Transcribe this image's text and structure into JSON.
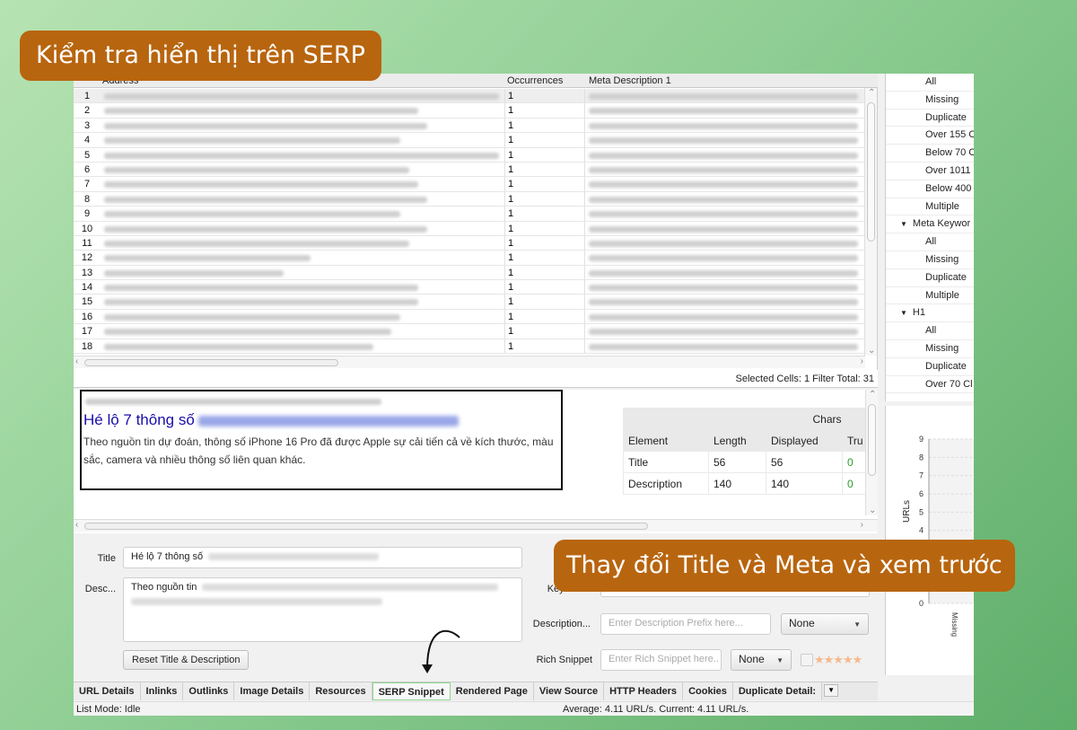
{
  "callouts": {
    "top": "Kiểm tra hiển thị trên SERP",
    "bottom": "Thay đổi Title và Meta và xem trước"
  },
  "grid": {
    "columns": [
      "Address",
      "Occurrences",
      "Meta Description 1"
    ],
    "rows": [
      {
        "n": "1",
        "occ": "1"
      },
      {
        "n": "2",
        "occ": "1"
      },
      {
        "n": "3",
        "occ": "1"
      },
      {
        "n": "4",
        "occ": "1"
      },
      {
        "n": "5",
        "occ": "1"
      },
      {
        "n": "6",
        "occ": "1"
      },
      {
        "n": "7",
        "occ": "1"
      },
      {
        "n": "8",
        "occ": "1"
      },
      {
        "n": "9",
        "occ": "1"
      },
      {
        "n": "10",
        "occ": "1"
      },
      {
        "n": "11",
        "occ": "1"
      },
      {
        "n": "12",
        "occ": "1"
      },
      {
        "n": "13",
        "occ": "1"
      },
      {
        "n": "14",
        "occ": "1"
      },
      {
        "n": "15",
        "occ": "1"
      },
      {
        "n": "16",
        "occ": "1"
      },
      {
        "n": "17",
        "occ": "1"
      },
      {
        "n": "18",
        "occ": "1"
      }
    ],
    "filter_status": "Selected Cells: 1  Filter Total:  31"
  },
  "tree": [
    {
      "label": "All",
      "type": "child"
    },
    {
      "label": "Missing",
      "type": "child"
    },
    {
      "label": "Duplicate",
      "type": "child"
    },
    {
      "label": "Over 155 C",
      "type": "child"
    },
    {
      "label": "Below 70 C",
      "type": "child"
    },
    {
      "label": "Over 1011",
      "type": "child"
    },
    {
      "label": "Below 400",
      "type": "child"
    },
    {
      "label": "Multiple",
      "type": "child"
    },
    {
      "label": "Meta Keywor",
      "type": "parent"
    },
    {
      "label": "All",
      "type": "child"
    },
    {
      "label": "Missing",
      "type": "child"
    },
    {
      "label": "Duplicate",
      "type": "child"
    },
    {
      "label": "Multiple",
      "type": "child"
    },
    {
      "label": "H1",
      "type": "parent"
    },
    {
      "label": "All",
      "type": "child"
    },
    {
      "label": "Missing",
      "type": "child"
    },
    {
      "label": "Duplicate",
      "type": "child"
    },
    {
      "label": "Over 70 Cl",
      "type": "child"
    }
  ],
  "chart_data": {
    "type": "bar",
    "ylabel": "URLs",
    "yticks": [
      "9",
      "8",
      "7",
      "6",
      "5",
      "4",
      "0"
    ],
    "ylim": [
      0,
      9
    ],
    "categories": [
      "Missing"
    ],
    "values": [
      0
    ]
  },
  "serp": {
    "title_visible": "Hé lộ 7 thông số",
    "description": "Theo nguồn tin dự đoán, thông số iPhone 16 Pro đã được Apple sự cải tiến cả về kích thước, màu sắc, camera và nhiều thông số liên quan khác."
  },
  "chars_table": {
    "group_header": "Chars",
    "headers": [
      "Element",
      "Length",
      "Displayed",
      "Tru"
    ],
    "rows": [
      {
        "element": "Title",
        "length": "56",
        "displayed": "56",
        "truncated": "0"
      },
      {
        "element": "Description",
        "length": "140",
        "displayed": "140",
        "truncated": "0"
      }
    ]
  },
  "editor": {
    "title_label": "Title",
    "title_value": "Hé lộ 7 thông số",
    "desc_label": "Desc...",
    "desc_value": "Theo nguồn tin",
    "reset_button": "Reset Title & Description",
    "keyword_label": "Keywords",
    "desc_prefix_label": "Description...",
    "desc_prefix_placeholder": "Enter Description Prefix here...",
    "desc_prefix_select": "None",
    "rich_snippet_label": "Rich Snippet",
    "rich_snippet_placeholder": "Enter Rich Snippet here..",
    "rich_snippet_select": "None",
    "stars": "★★★★★"
  },
  "tabs": [
    "URL Details",
    "Inlinks",
    "Outlinks",
    "Image Details",
    "Resources",
    "SERP Snippet",
    "Rendered Page",
    "View Source",
    "HTTP Headers",
    "Cookies",
    "Duplicate Detail:"
  ],
  "active_tab": "SERP Snippet",
  "status": {
    "mode": "List Mode: Idle",
    "speed": "Average: 4.11 URL/s. Current: 4.11 URL/s."
  },
  "colors": {
    "callout": "#b8650f",
    "serp_title": "#1a0dab",
    "zero_value": "#2b9a2b",
    "active_tab_border": "#8fd48f"
  }
}
